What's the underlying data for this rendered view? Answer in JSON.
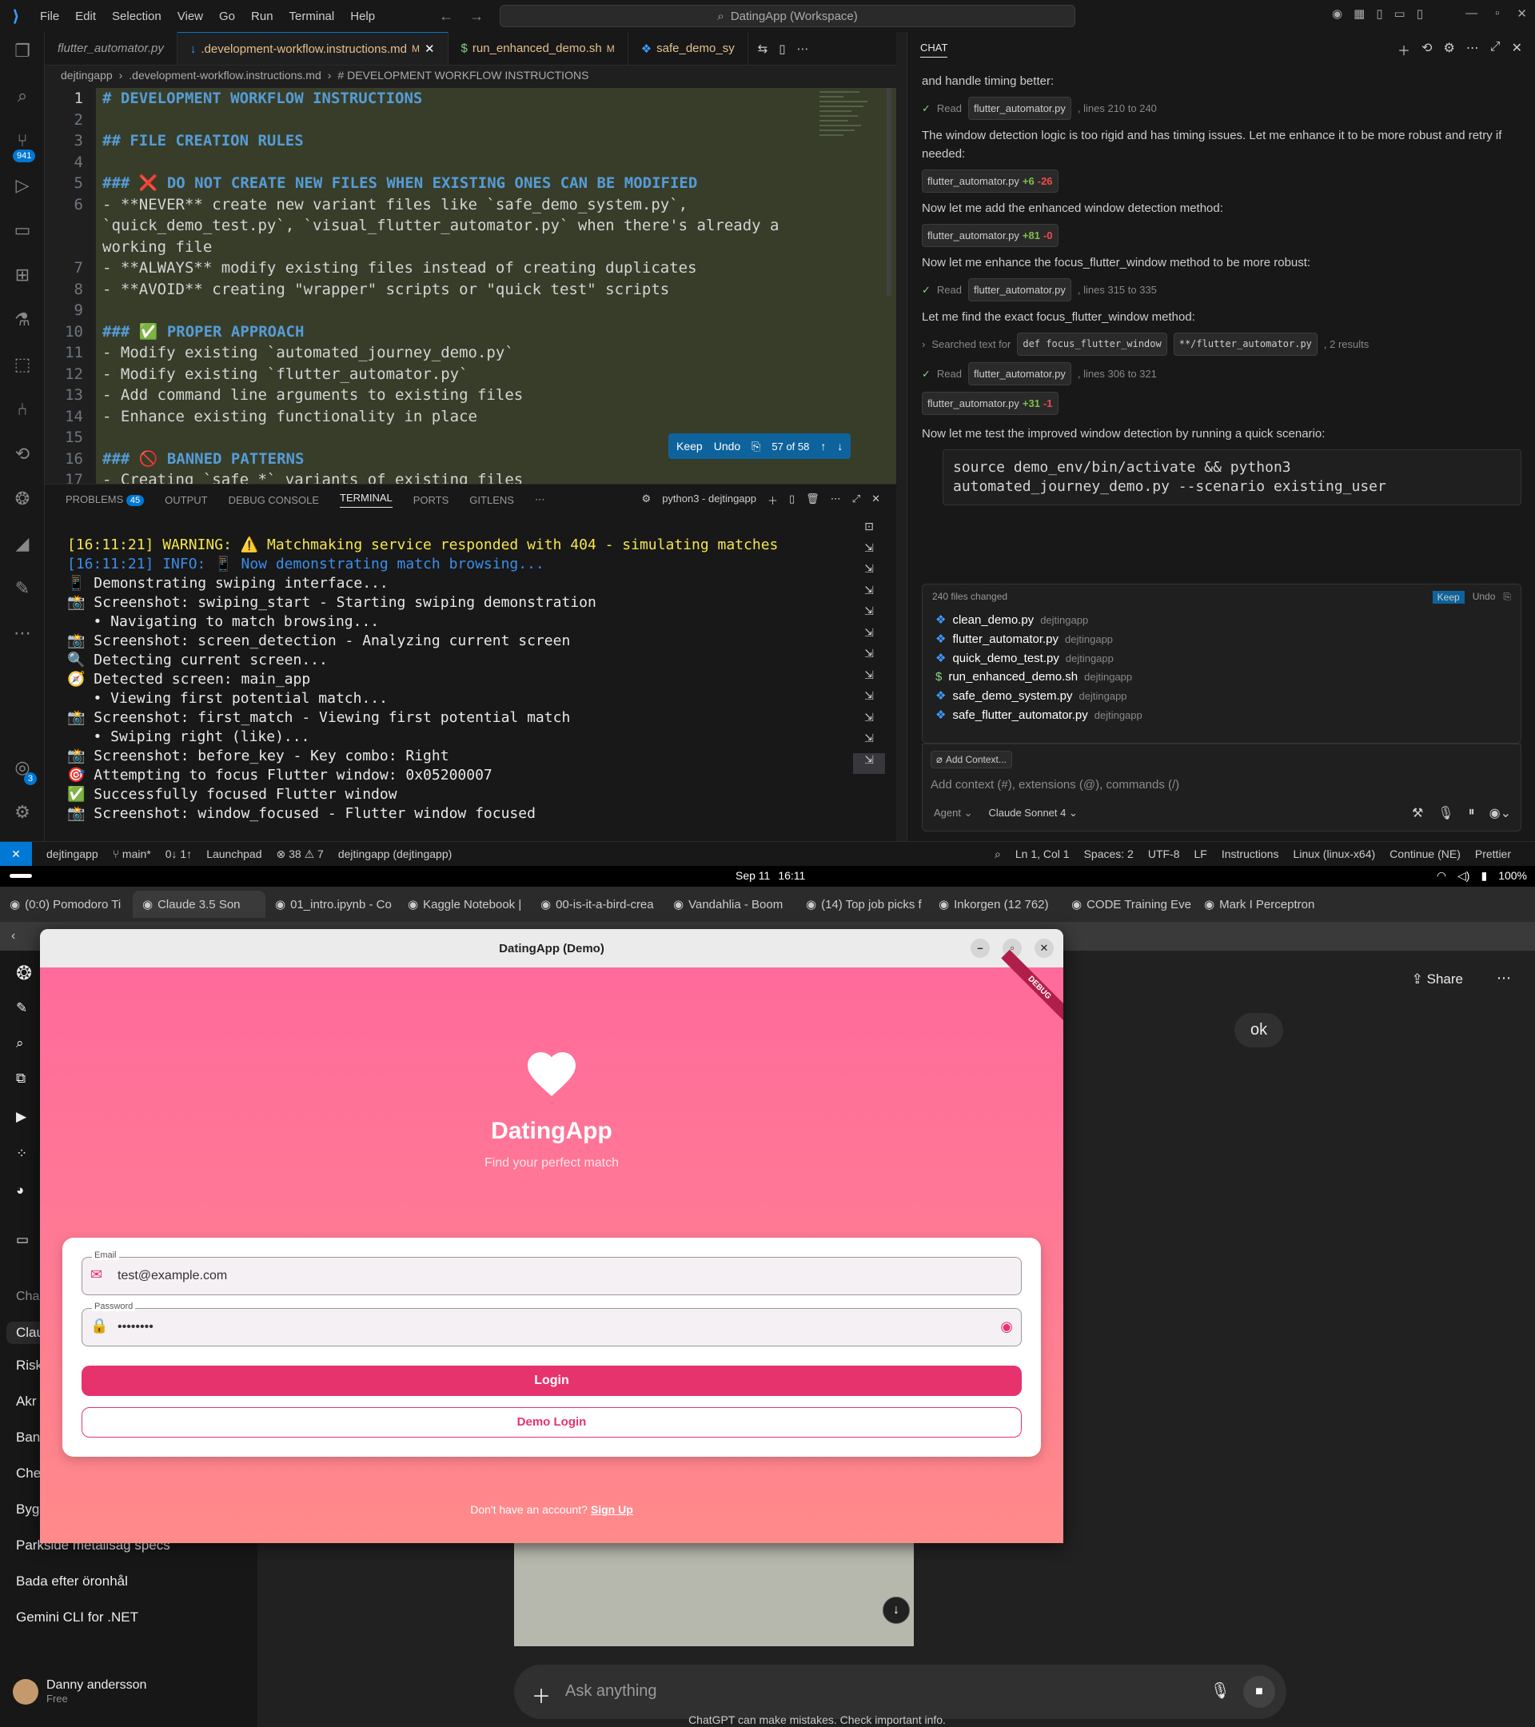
{
  "vscode": {
    "menu": [
      "File",
      "Edit",
      "Selection",
      "View",
      "Go",
      "Run",
      "Terminal",
      "Help"
    ],
    "command_center": "DatingApp (Workspace)",
    "tabs": [
      {
        "label": "flutter_automator.py"
      },
      {
        "label": ".development-workflow.instructions.md",
        "modified": "M"
      },
      {
        "label": "run_enhanced_demo.sh",
        "modified": "M"
      },
      {
        "label": "safe_demo_sy"
      }
    ],
    "breadcrumb": [
      "dejtingapp",
      ".development-workflow.instructions.md",
      "# DEVELOPMENT WORKFLOW INSTRUCTIONS"
    ],
    "badges": {
      "scm": "941",
      "accounts": "3"
    },
    "code_lines": [
      {
        "n": "1",
        "text": "# DEVELOPMENT WORKFLOW INSTRUCTIONS"
      },
      {
        "n": "2",
        "text": ""
      },
      {
        "n": "3",
        "text": "## FILE CREATION RULES"
      },
      {
        "n": "4",
        "text": ""
      },
      {
        "n": "5",
        "text": "### ❌ DO NOT CREATE NEW FILES WHEN EXISTING ONES CAN BE MODIFIED"
      },
      {
        "n": "6",
        "text": "- **NEVER** create new variant files like `safe_demo_system.py`,"
      },
      {
        "n": "",
        "text": "`quick_demo_test.py`, `visual_flutter_automator.py` when there's already a"
      },
      {
        "n": "",
        "text": "working file"
      },
      {
        "n": "7",
        "text": "- **ALWAYS** modify existing files instead of creating duplicates"
      },
      {
        "n": "8",
        "text": "- **AVOID** creating \"wrapper\" scripts or \"quick test\" scripts"
      },
      {
        "n": "9",
        "text": ""
      },
      {
        "n": "10",
        "text": "### ✅ PROPER APPROACH"
      },
      {
        "n": "11",
        "text": "- Modify existing `automated_journey_demo.py`"
      },
      {
        "n": "12",
        "text": "- Modify existing `flutter_automator.py`"
      },
      {
        "n": "13",
        "text": "- Add command line arguments to existing files"
      },
      {
        "n": "14",
        "text": "- Enhance existing functionality in place"
      },
      {
        "n": "15",
        "text": ""
      },
      {
        "n": "16",
        "text": "### 🚫 BANNED PATTERNS"
      },
      {
        "n": "17",
        "text": "- Creating `safe_*` variants of existing files"
      }
    ],
    "inline_bar": {
      "keep": "Keep",
      "undo": "Undo",
      "counter": "57 of 58"
    },
    "panel_tabs": [
      "PROBLEMS",
      "OUTPUT",
      "DEBUG CONSOLE",
      "TERMINAL",
      "PORTS",
      "GITLENS"
    ],
    "problems_count": "45",
    "terminal_name": "python3 - dejtingapp",
    "terminal_lines": [
      "[16:11:21] WARNING: ⚠️ Matchmaking service responded with 404 - simulating matches",
      "[16:11:21] INFO: 📱 Now demonstrating match browsing...",
      "📱 Demonstrating swiping interface...",
      "📸 Screenshot: swiping_start - Starting swiping demonstration",
      "   • Navigating to match browsing...",
      "📸 Screenshot: screen_detection - Analyzing current screen",
      "🔍 Detecting current screen...",
      "🧭 Detected screen: main_app",
      "   • Viewing first potential match...",
      "📸 Screenshot: first_match - Viewing first potential match",
      "   • Swiping right (like)...",
      "📸 Screenshot: before_key - Key combo: Right",
      "🎯 Attempting to focus Flutter window: 0x05200007",
      "✅ Successfully focused Flutter window",
      "📸 Screenshot: window_focused - Flutter window focused"
    ],
    "chat": {
      "title": "CHAT",
      "messages": [
        {
          "type": "text",
          "text": "and handle timing better:"
        },
        {
          "type": "read",
          "label": "Read",
          "file": "flutter_automator.py",
          "range": ", lines 210 to 240"
        },
        {
          "type": "text",
          "text": "The window detection logic is too rigid and has timing issues. Let me enhance it to be more robust and retry if needed:"
        },
        {
          "type": "edit",
          "file": "flutter_automator.py",
          "plus": "+6",
          "minus": "-26"
        },
        {
          "type": "text",
          "text": "Now let me add the enhanced window detection method:"
        },
        {
          "type": "edit",
          "file": "flutter_automator.py",
          "plus": "+81",
          "minus": "-0"
        },
        {
          "type": "text",
          "text": "Now let me enhance the focus_flutter_window method to be more robust:"
        },
        {
          "type": "read",
          "label": "Read",
          "file": "flutter_automator.py",
          "range": ", lines 315 to 335"
        },
        {
          "type": "text",
          "text": "Let me find the exact focus_flutter_window method:"
        },
        {
          "type": "search",
          "label": "Searched text for",
          "query": "def focus_flutter_window",
          "glob": "**/flutter_automator.py",
          "result": ", 2 results"
        },
        {
          "type": "read",
          "label": "Read",
          "file": "flutter_automator.py",
          "range": ", lines 306 to 321"
        },
        {
          "type": "edit",
          "file": "flutter_automator.py",
          "plus": "+31",
          "minus": "-1"
        },
        {
          "type": "text",
          "text": "Now let me test the improved window detection by running a quick scenario:"
        }
      ],
      "command": "source demo_env/bin/activate && python3 automated_journey_demo.py --scenario existing_user",
      "files_changed": "240 files changed",
      "keep": "Keep",
      "undo": "Undo",
      "files": [
        {
          "name": "clean_demo.py",
          "dir": "dejtingapp"
        },
        {
          "name": "flutter_automator.py",
          "dir": "dejtingapp"
        },
        {
          "name": "quick_demo_test.py",
          "dir": "dejtingapp"
        },
        {
          "name": "run_enhanced_demo.sh",
          "dir": "dejtingapp"
        },
        {
          "name": "safe_demo_system.py",
          "dir": "dejtingapp"
        },
        {
          "name": "safe_flutter_automator.py",
          "dir": "dejtingapp"
        }
      ],
      "add_context": "Add Context...",
      "input_placeholder": "Add context (#), extensions (@), commands (/)",
      "mode": "Agent",
      "model": "Claude Sonnet 4"
    },
    "status": {
      "branch_folder": "dejtingapp",
      "branch": "main*",
      "sync": "0↓ 1↑",
      "launchpad": "Launchpad",
      "problems": "38",
      "warnings": "7",
      "project": "dejtingapp (dejtingapp)",
      "position": "Ln 1, Col 1",
      "spaces": "Spaces: 2",
      "encoding": "UTF-8",
      "eol": "LF",
      "language": "Instructions",
      "os": "Linux (linux-x64)",
      "continue": "Continue (NE)",
      "prettier": "Prettier"
    }
  },
  "gnome": {
    "date": "Sep 11",
    "time": "16:11",
    "battery": "100%"
  },
  "browser": {
    "tabs": [
      "(0:0) Pomodoro Ti",
      "Claude 3.5 Son",
      "01_intro.ipynb - Co",
      "Kaggle Notebook |",
      "00-is-it-a-bird-crea",
      "Vandahlia - Boom",
      "(14) Top job picks f",
      "Inkorgen (12 762)",
      "CODE Training Eve",
      "Mark I Perceptron"
    ],
    "chatgpt": {
      "share": "Share",
      "user_message": "ok",
      "sidebar_section": "Cha",
      "sidebar_items": [
        "Clau",
        "Risk",
        "Akr",
        "Ban",
        "Che",
        "Bygga om metallsåg till bandsåg",
        "Parkside metallsåg specs",
        "Bada efter öronhål",
        "Gemini CLI for .NET"
      ],
      "user_name": "Danny andersson",
      "plan": "Free",
      "ask_placeholder": "Ask anything",
      "disclaimer": "ChatGPT can make mistakes. Check important info."
    }
  },
  "flutter": {
    "window_title": "DatingApp (Demo)",
    "debug_banner": "DEBUG",
    "app_name": "DatingApp",
    "tagline": "Find your perfect match",
    "email_label": "Email",
    "email_value": "test@example.com",
    "password_label": "Password",
    "password_value": "••••••••",
    "login": "Login",
    "demo_login": "Demo Login",
    "no_account": "Don't have an account?",
    "sign_up": "Sign Up",
    "colors": {
      "primary": "#e6336e",
      "gradient_top": "#ff6b9c",
      "gradient_bottom": "#ff8a8a"
    }
  }
}
